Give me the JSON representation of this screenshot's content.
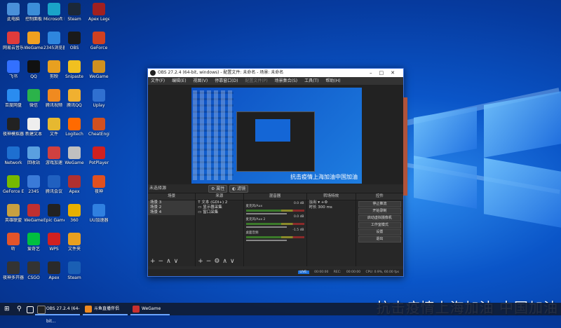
{
  "desktop_icons": [
    {
      "label": "此电脑",
      "color": "#4a90d9"
    },
    {
      "label": "网易云音乐",
      "color": "#e03b3b"
    },
    {
      "label": "飞书",
      "color": "#3370ff"
    },
    {
      "label": "百度网盘",
      "color": "#2a8cf0"
    },
    {
      "label": "夜神模拟器",
      "color": "#222"
    },
    {
      "label": "Network",
      "color": "#1e6fd0"
    },
    {
      "label": "GeForce Experience",
      "color": "#76b900"
    },
    {
      "label": "英雄联盟",
      "color": "#c8a040"
    },
    {
      "label": "听",
      "color": "#e2542a"
    },
    {
      "label": "夜神多开器",
      "color": "#333"
    },
    {
      "label": "控制面板",
      "color": "#3c8ed8"
    },
    {
      "label": "WeGame",
      "color": "#f0a020"
    },
    {
      "label": "QQ",
      "color": "#111"
    },
    {
      "label": "微信",
      "color": "#2bb34a"
    },
    {
      "label": "新建文本",
      "color": "#eee"
    },
    {
      "label": "回收站",
      "color": "#5aa0e0"
    },
    {
      "label": "2345",
      "color": "#3a7ad8"
    },
    {
      "label": "WeGame",
      "color": "#c03030"
    },
    {
      "label": "爱奇艺",
      "color": "#00c040"
    },
    {
      "label": "CSGO",
      "color": "#333"
    },
    {
      "label": "Microsoft Edge",
      "color": "#1aa3c8"
    },
    {
      "label": "2345浏览器",
      "color": "#2e86de"
    },
    {
      "label": "剪映",
      "color": "#e8a020"
    },
    {
      "label": "腾讯视频",
      "color": "#f08a20"
    },
    {
      "label": "文件",
      "color": "#e6b830"
    },
    {
      "label": "游戏加速",
      "color": "#d04040"
    },
    {
      "label": "腾讯会议",
      "color": "#2060c0"
    },
    {
      "label": "Epic Games",
      "color": "#222"
    },
    {
      "label": "WPS",
      "color": "#d02020"
    },
    {
      "label": "Apex",
      "color": "#2a2a2a"
    },
    {
      "label": "Steam",
      "color": "#1b2838"
    },
    {
      "label": "OBS",
      "color": "#1a1a1a"
    },
    {
      "label": "Snipaste",
      "color": "#f0c020"
    },
    {
      "label": "腾讯QQ",
      "color": "#f0b030"
    },
    {
      "label": "Logitech",
      "color": "#ff6a00"
    },
    {
      "label": "WeGame",
      "color": "#c0c0c0"
    },
    {
      "label": "Apex",
      "color": "#b03030"
    },
    {
      "label": "360",
      "color": "#e8b000"
    },
    {
      "label": "文件夹",
      "color": "#e8a020"
    },
    {
      "label": "Steam",
      "color": "#1a5fb4"
    },
    {
      "label": "Apex Legends",
      "color": "#a02020"
    },
    {
      "label": "GeForce",
      "color": "#d04020"
    },
    {
      "label": "WeGame",
      "color": "#d09020"
    },
    {
      "label": "Uplay",
      "color": "#3070d0"
    },
    {
      "label": "CheatEngine",
      "color": "#d05020"
    },
    {
      "label": "PotPlayer",
      "color": "#d02020"
    },
    {
      "label": "夜神",
      "color": "#e05020"
    },
    {
      "label": "UU加速器",
      "color": "#3080e0"
    }
  ],
  "obs": {
    "title": "OBS 27.2.4 (64-bit, windows) - 配置文件: 未命名 - 场景: 未命名",
    "menu": [
      "文件(F)",
      "编辑(E)",
      "视图(V)",
      "停靠窗口(D)",
      "配置文件(P)",
      "场景集合(S)",
      "工具(T)",
      "帮助(H)"
    ],
    "preview_subtitle": "抗击疫情上海加油中国加油",
    "no_source_label": "未选择源",
    "properties_label": "属性",
    "filters_label": "滤镜",
    "scenes_header": "场景",
    "scenes": [
      "场景 3",
      "场景 2",
      "场景 4"
    ],
    "sources_header": "来源",
    "sources": [
      "文本 (GDI+) 2",
      "显示器采集",
      "窗口采集"
    ],
    "mixer_header": "混音器",
    "mixer": [
      {
        "name": "麦克风/Aux",
        "db": "0.0 dB"
      },
      {
        "name": "麦克风/Aux 2",
        "db": "0.0 dB"
      },
      {
        "name": "桌面音频",
        "db": "-1.5 dB"
      }
    ],
    "transitions_header": "转场特效",
    "transition_type": "淡出",
    "duration_label": "时长",
    "duration_value": "300 ms",
    "controls_header": "控件",
    "controls": [
      "停止推流",
      "开始录制",
      "启动虚拟摄像机",
      "工作室模式",
      "设置",
      "退出"
    ],
    "status": {
      "live": "LIVE:",
      "live_time": "00:00:00",
      "rec": "REC:",
      "rec_time": "00:00:00",
      "cpu": "CPU: 0.9%, 60.00 fps"
    }
  },
  "overlay_text": "抗击疫情上海加油 中国加油",
  "taskbar": {
    "apps": [
      {
        "label": "OBS 27.2.4 (64-bit...",
        "color": "#222"
      },
      {
        "label": "斗鱼直播伴侣",
        "color": "#f08a20"
      },
      {
        "label": "WeGame",
        "color": "#c83030"
      }
    ]
  }
}
